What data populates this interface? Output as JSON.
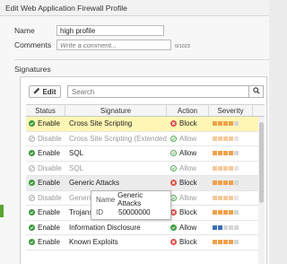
{
  "window": {
    "title": "Edit Web Application Firewall Profile"
  },
  "form": {
    "name_label": "Name",
    "name_value": "high profile",
    "comments_label": "Comments",
    "comments_placeholder": "Write a comment...",
    "comments_counter": "0/1023"
  },
  "signatures": {
    "heading": "Signatures",
    "edit_label": "Edit",
    "search_placeholder": "Search",
    "columns": {
      "status": "Status",
      "signature": "Signature",
      "action": "Action",
      "severity": "Severity"
    },
    "rows": [
      {
        "status": "Enable",
        "signature": "Cross Site Scripting",
        "action": "Block"
      },
      {
        "status": "Disable",
        "signature": "Cross Site Scripting (Extended)",
        "action": "Allow"
      },
      {
        "status": "Enable",
        "signature": "SQL",
        "action": "Allow"
      },
      {
        "status": "Disable",
        "signature": "SQL",
        "action": "Allow"
      },
      {
        "status": "Enable",
        "signature": "Generic Attacks",
        "action": "Block"
      },
      {
        "status": "Disable",
        "signature": "Generic Attacks(Extended)",
        "action": "Allow"
      },
      {
        "status": "Enable",
        "signature": "Trojans",
        "action": "Block"
      },
      {
        "status": "Enable",
        "signature": "Information Disclosure",
        "action": "Allow"
      },
      {
        "status": "Enable",
        "signature": "Known Exploits",
        "action": "Block"
      }
    ],
    "tooltip": {
      "name_key": "Name",
      "name_value": "Generic Attacks",
      "id_key": "ID",
      "id_value": "50000000"
    }
  },
  "colors": {
    "enable_green": "#3c9a3c",
    "block_red": "#d9534f",
    "selected_row": "#fdf6b4",
    "severity_orange": "#f0a14b",
    "severity_blue": "#3b6fb6",
    "severity_gray": "#d6d6d6"
  }
}
